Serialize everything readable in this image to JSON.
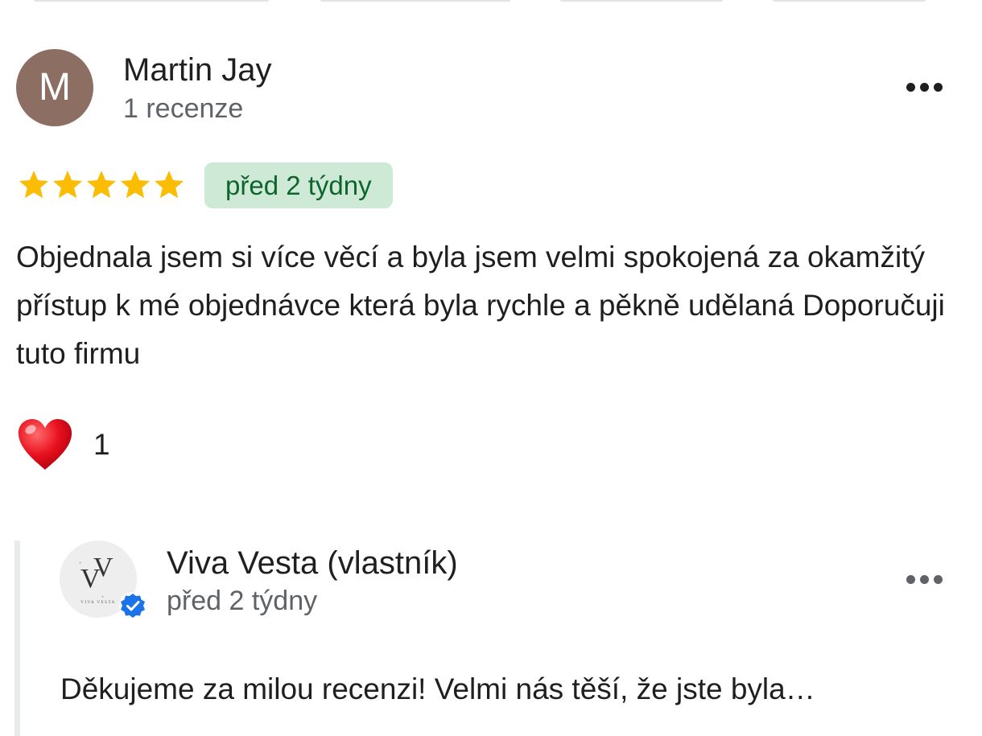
{
  "review": {
    "avatar_letter": "M",
    "avatar_color": "#8d6e63",
    "author_name": "Martin Jay",
    "author_meta": "1 recenze",
    "more_icon": "more-horiz-icon",
    "rating": 5,
    "rating_max": 5,
    "star_color": "#fbbc04",
    "time_badge": "před 2 týdny",
    "text": "Objednala jsem si více věcí a byla jsem velmi spokojená za okamžitý přístup k mé objednávce která byla rychle a pěkně udělaná Doporučuji tuto firmu",
    "reaction": {
      "icon": "heart-icon",
      "count": "1"
    }
  },
  "owner_reply": {
    "logo_text": "VIVA VESTA",
    "verified_icon": "verified-badge-icon",
    "verified_color": "#1a73e8",
    "author_name": "Viva Vesta (vlastník)",
    "time": "před 2 týdny",
    "more_icon": "more-horiz-icon",
    "text": "Děkujeme za milou recenzi! Velmi nás těší, že jste byla…"
  }
}
